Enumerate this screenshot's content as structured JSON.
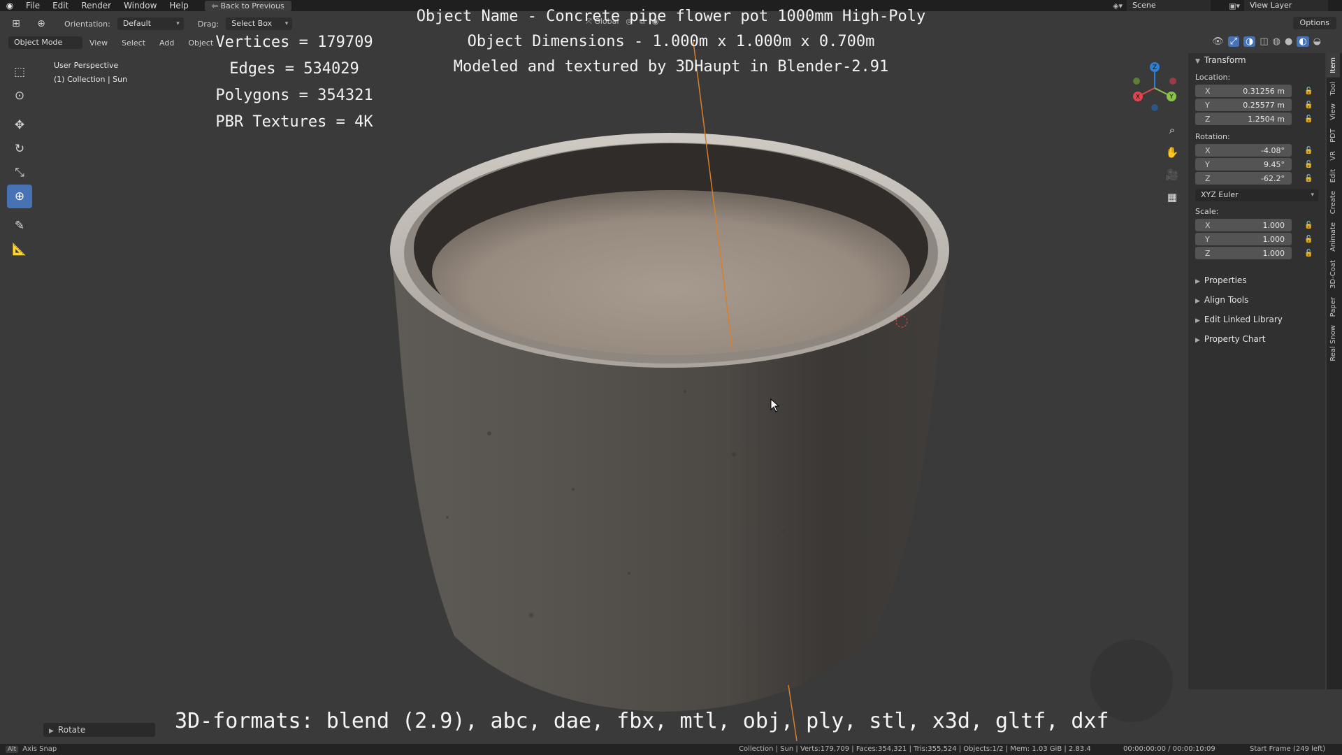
{
  "menu": {
    "items": [
      "File",
      "Edit",
      "Render",
      "Window",
      "Help"
    ],
    "back_button": "Back to Previous",
    "scene": "Scene",
    "view_layer": "View Layer"
  },
  "header": {
    "orientation_label": "Orientation:",
    "orientation_value": "Default",
    "drag_label": "Drag:",
    "drag_value": "Select Box",
    "transform_space": "Global",
    "options": "Options",
    "mode": "Object Mode",
    "menus": [
      "View",
      "Select",
      "Add",
      "Object"
    ]
  },
  "viewport": {
    "perspective": "User Perspective",
    "collection": "(1) Collection | Sun"
  },
  "overlay": {
    "stats": [
      "Vertices = 179709",
      "Edges = 534029",
      "Polygons = 354321",
      "PBR Textures = 4K"
    ],
    "title_lines": [
      "Object Name - Concrete pipe flower pot 1000mm High-Poly",
      "Object Dimensions -  1.000m x 1.000m x 0.700m",
      "Modeled and textured by 3DHaupt in Blender-2.91"
    ],
    "formats": "3D-formats: blend (2.9), abc, dae, fbx, mtl, obj, ply, stl, x3d, gltf, dxf"
  },
  "npanel": {
    "transform_title": "Transform",
    "location_label": "Location:",
    "location": [
      {
        "axis": "X",
        "value": "0.31256 m"
      },
      {
        "axis": "Y",
        "value": "0.25577 m"
      },
      {
        "axis": "Z",
        "value": "1.2504 m"
      }
    ],
    "rotation_label": "Rotation:",
    "rotation": [
      {
        "axis": "X",
        "value": "-4.08°"
      },
      {
        "axis": "Y",
        "value": "9.45°"
      },
      {
        "axis": "Z",
        "value": "-62.2°"
      }
    ],
    "rotation_mode": "XYZ Euler",
    "scale_label": "Scale:",
    "scale": [
      {
        "axis": "X",
        "value": "1.000"
      },
      {
        "axis": "Y",
        "value": "1.000"
      },
      {
        "axis": "Z",
        "value": "1.000"
      }
    ],
    "subpanels": [
      "Properties",
      "Align Tools",
      "Edit Linked Library",
      "Property Chart"
    ]
  },
  "vtabs": [
    "Item",
    "Tool",
    "View",
    "PDT",
    "VR",
    "Edit",
    "Create",
    "Animate",
    "3D-Coat",
    "Paper",
    "Real Snow"
  ],
  "bottom": {
    "last_operator": "Rotate",
    "status_key": "Alt",
    "status_hint": "Axis Snap",
    "status_stats": "Collection | Sun | Verts:179,709 | Faces:354,321 | Tris:355,524 | Objects:1/2 | Mem: 1.03 GiB | 2.83.4",
    "time": "00:00:00:00 / 00:00:10:09",
    "frame": "Start Frame (249 left)"
  },
  "colors": {
    "accent": "#4772b3",
    "viewport_bg": "#3a3a3a",
    "panel_bg": "#303030"
  }
}
